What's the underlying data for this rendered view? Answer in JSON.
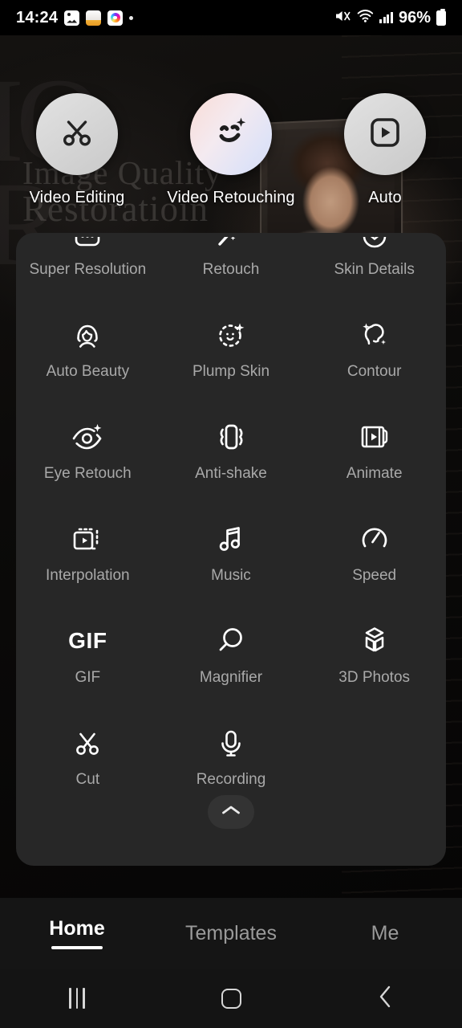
{
  "status_bar": {
    "time": "14:24",
    "tray_icons": [
      "gallery-icon",
      "note-icon",
      "camera-icon",
      "dot-indicator"
    ],
    "mute_icon": "volume-mute-icon",
    "wifi_icon": "wifi-icon",
    "signal_icon": "cellular-signal-icon",
    "battery_percent": "96%",
    "battery_icon": "battery-icon"
  },
  "background": {
    "title_line1": "Image Quality",
    "title_line2": "Restoratioin",
    "watermark": "IQ\nR"
  },
  "quick_actions": [
    {
      "label": "Video Editing",
      "icon": "scissors-icon",
      "style": "grey"
    },
    {
      "label": "Video Retouching",
      "icon": "smiley-sparkle-icon",
      "style": "gradient"
    },
    {
      "label": "Auto",
      "icon": "play-square-icon",
      "style": "grey"
    }
  ],
  "tools": [
    {
      "label": "Super Resolution",
      "icon": "sparkle-frame-icon",
      "clipped": true
    },
    {
      "label": "Retouch",
      "icon": "magic-wand-icon",
      "clipped": true
    },
    {
      "label": "Skin Details",
      "icon": "face-smile-icon",
      "clipped": true
    },
    {
      "label": "Auto Beauty",
      "icon": "portrait-beauty-icon",
      "clipped": false
    },
    {
      "label": "Plump Skin",
      "icon": "dotted-face-sparkle-icon",
      "clipped": false
    },
    {
      "label": "Contour",
      "icon": "face-contour-icon",
      "clipped": false
    },
    {
      "label": "Eye Retouch",
      "icon": "eye-sparkle-icon",
      "clipped": false
    },
    {
      "label": "Anti-shake",
      "icon": "stabilize-icon",
      "clipped": false
    },
    {
      "label": "Animate",
      "icon": "film-play-icon",
      "clipped": false
    },
    {
      "label": "Interpolation",
      "icon": "frame-interpolate-icon",
      "clipped": false
    },
    {
      "label": "Music",
      "icon": "music-note-icon",
      "clipped": false
    },
    {
      "label": "Speed",
      "icon": "speedometer-icon",
      "clipped": false
    },
    {
      "label": "GIF",
      "icon": "gif-text-icon",
      "clipped": false
    },
    {
      "label": "Magnifier",
      "icon": "magnifier-icon",
      "clipped": false
    },
    {
      "label": "3D Photos",
      "icon": "cube-3d-icon",
      "clipped": false
    },
    {
      "label": "Cut",
      "icon": "scissors-icon",
      "clipped": false
    },
    {
      "label": "Recording",
      "icon": "microphone-icon",
      "clipped": false
    }
  ],
  "panel": {
    "collapse_icon": "chevron-up-icon"
  },
  "bottom_nav": {
    "tabs": [
      {
        "label": "Home",
        "active": true
      },
      {
        "label": "Templates",
        "active": false
      },
      {
        "label": "Me",
        "active": false
      }
    ]
  },
  "system_nav": {
    "recents_icon": "recents-icon",
    "home_icon": "home-icon",
    "back_icon": "back-icon"
  },
  "colors": {
    "panel_bg": "#272727",
    "label_grey": "#a9a9a9",
    "active_white": "#ffffff",
    "bottom_nav_bg": "#151515"
  }
}
